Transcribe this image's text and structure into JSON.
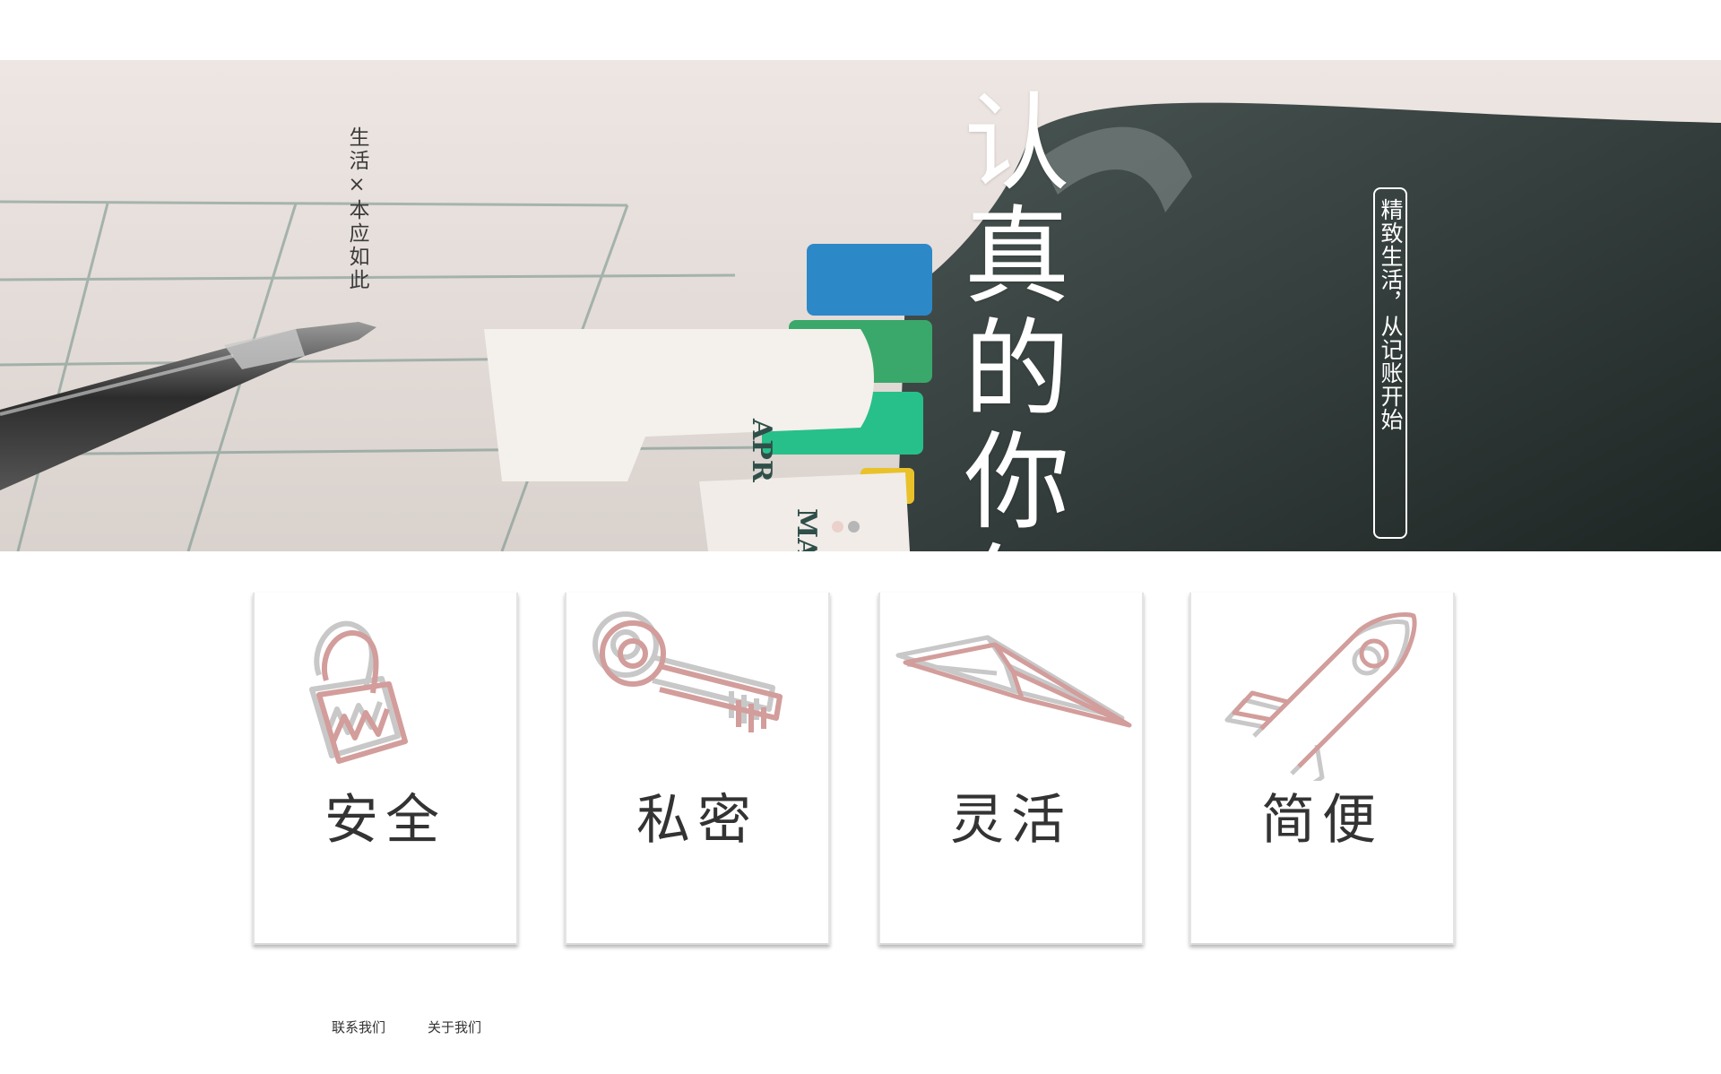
{
  "hero": {
    "tagline": "生活×本应如此",
    "headline": "认真的你每一个致敬",
    "subtitle": "精致生活，从记账开始",
    "slides": [
      {
        "active": true
      },
      {
        "active": false
      }
    ]
  },
  "features": [
    {
      "label": "安全",
      "icon": "padlock-icon"
    },
    {
      "label": "私密",
      "icon": "key-icon"
    },
    {
      "label": "灵活",
      "icon": "paper-plane-icon"
    },
    {
      "label": "简便",
      "icon": "rocket-icon"
    }
  ],
  "footer": {
    "contact_label": "联系我们",
    "about_label": "关于我们"
  },
  "colors": {
    "icon_primary": "#d29d9b",
    "icon_secondary": "#c8c8c8",
    "label_text": "#333333",
    "headline_text": "#ffffff"
  }
}
